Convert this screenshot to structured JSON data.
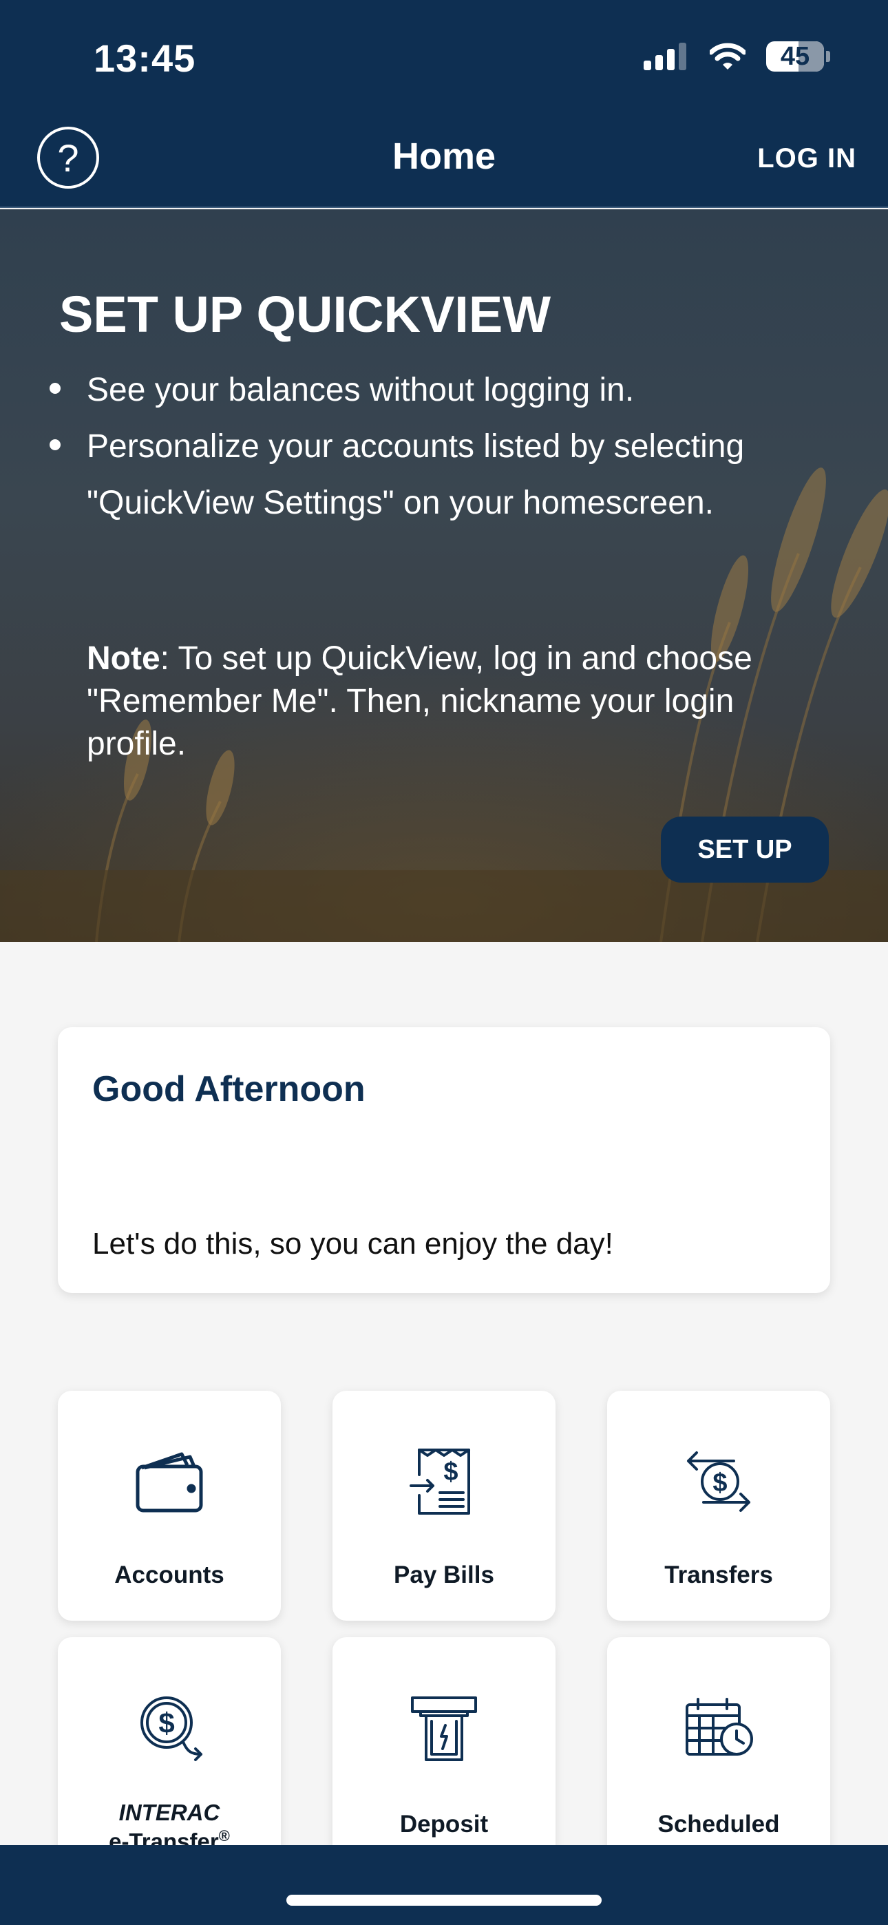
{
  "status_bar": {
    "time": "13:45",
    "battery": "45",
    "icons": [
      "signal-icon",
      "wifi-icon",
      "battery-icon"
    ]
  },
  "header": {
    "help_icon": "question-circle-icon",
    "help_glyph": "?",
    "title": "Home",
    "login_label": "LOG IN"
  },
  "hero": {
    "title": "SET UP QUICKVIEW",
    "bullets": [
      "See your balances without logging in.",
      "Personalize your accounts listed by selecting \"QuickView Settings\" on your homescreen."
    ],
    "note_label": "Note",
    "note_text": ": To set up QuickView, log in and choose \"Remember Me\". Then, nickname your login profile.",
    "setup_button": "SET UP"
  },
  "greeting": {
    "title": "Good Afternoon",
    "subtitle": "Let's do this, so you can enjoy the day!"
  },
  "tiles": [
    {
      "label": "Accounts",
      "icon": "wallet-icon"
    },
    {
      "label": "Pay Bills",
      "icon": "bill-receipt-icon"
    },
    {
      "label": "Transfers",
      "icon": "transfer-arrows-icon"
    },
    {
      "label_line1": "INTERAC",
      "label_line2": "e-Transfer",
      "label_mark": "®",
      "icon": "e-transfer-icon"
    },
    {
      "label": "Deposit",
      "icon": "deposit-atm-icon"
    },
    {
      "label": "Scheduled",
      "icon": "calendar-clock-icon"
    }
  ],
  "colors": {
    "navy": "#0e2f52",
    "background": "#f5f5f5",
    "card": "#ffffff"
  }
}
